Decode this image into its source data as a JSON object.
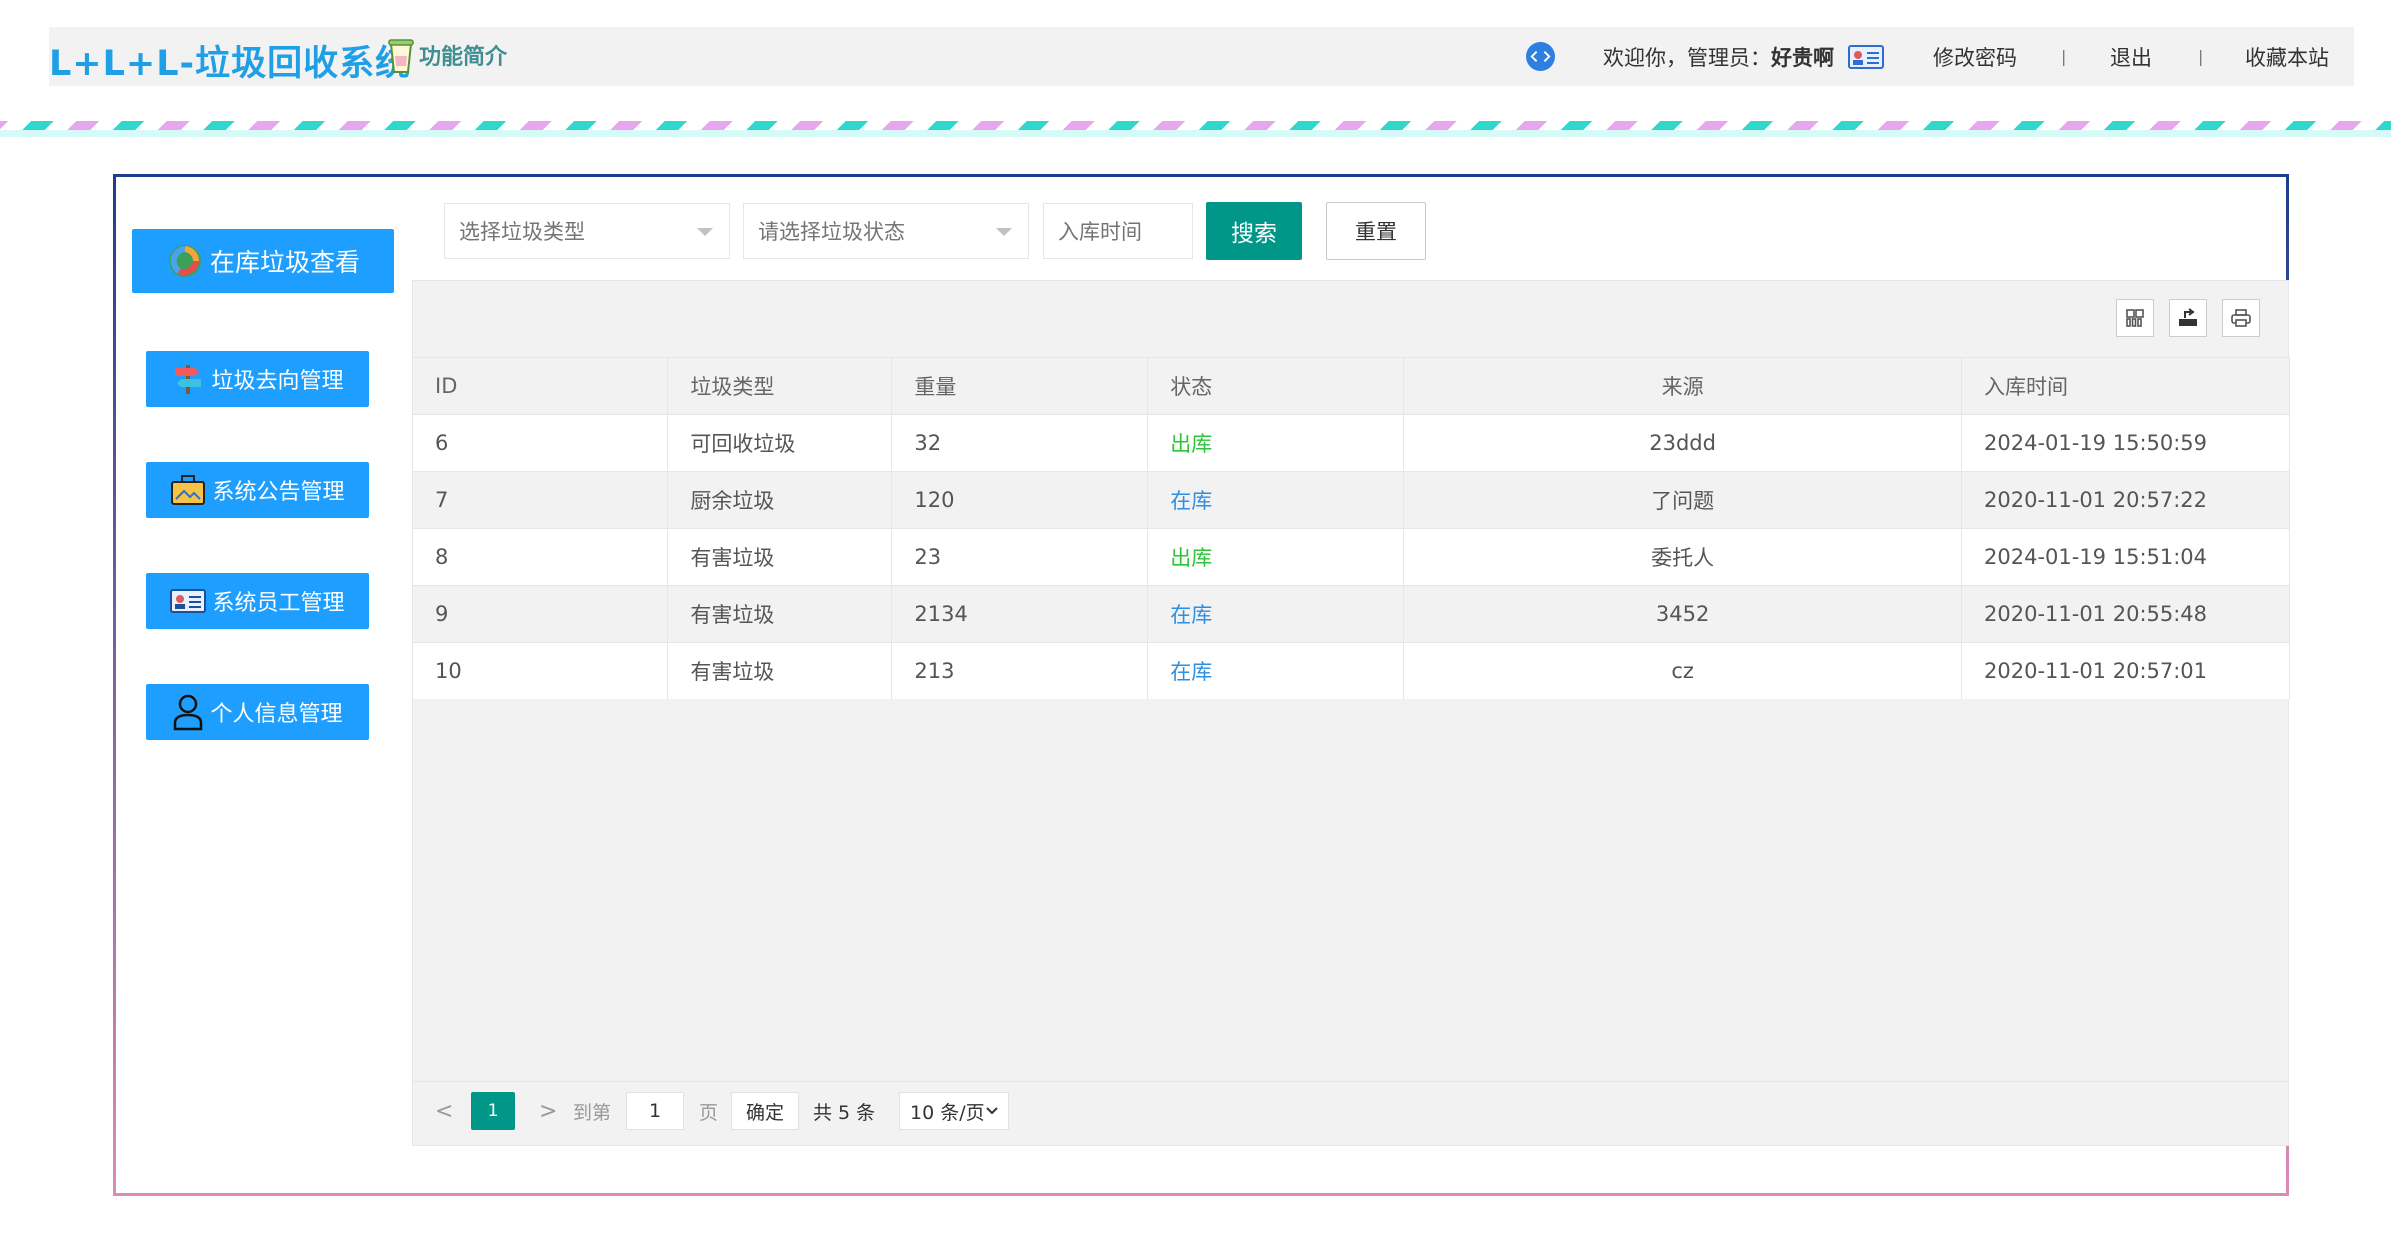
{
  "header": {
    "logo": "L+L+L-垃圾回收系统",
    "intro": "功能简介",
    "welcome_prefix": "欢迎你，管理员：",
    "username": "好贵啊",
    "change_password": "修改密码",
    "sep": "|",
    "logout": "退出",
    "bookmark": "收藏本站"
  },
  "sidebar": {
    "items": [
      {
        "label": "在库垃圾查看",
        "icon": "recycle-icon"
      },
      {
        "label": "垃圾去向管理",
        "icon": "signpost-icon"
      },
      {
        "label": "系统公告管理",
        "icon": "briefcase-icon"
      },
      {
        "label": "系统员工管理",
        "icon": "id-card-icon"
      },
      {
        "label": "个人信息管理",
        "icon": "user-icon"
      }
    ]
  },
  "search": {
    "type_placeholder": "选择垃圾类型",
    "status_placeholder": "请选择垃圾状态",
    "time_placeholder": "入库时间",
    "search_label": "搜索",
    "reset_label": "重置"
  },
  "table": {
    "columns": [
      "ID",
      "垃圾类型",
      "重量",
      "状态",
      "来源",
      "入库时间"
    ],
    "rows": [
      {
        "id": "6",
        "type": "可回收垃圾",
        "weight": "32",
        "status": "出库",
        "source": "23ddd",
        "time": "2024-01-19 15:50:59"
      },
      {
        "id": "7",
        "type": "厨余垃圾",
        "weight": "120",
        "status": "在库",
        "source": "了问题",
        "time": "2020-11-01 20:57:22"
      },
      {
        "id": "8",
        "type": "有害垃圾",
        "weight": "23",
        "status": "出库",
        "source": "委托人",
        "time": "2024-01-19 15:51:04"
      },
      {
        "id": "9",
        "type": "有害垃圾",
        "weight": "2134",
        "status": "在库",
        "source": "3452",
        "time": "2020-11-01 20:55:48"
      },
      {
        "id": "10",
        "type": "有害垃圾",
        "weight": "213",
        "status": "在库",
        "source": "cz",
        "time": "2020-11-01 20:57:01"
      }
    ]
  },
  "pager": {
    "prev": "<",
    "current": "1",
    "next": ">",
    "goto_label": "到第",
    "goto_value": "1",
    "page_unit": "页",
    "confirm": "确定",
    "total": "共 5 条",
    "page_size": "10 条/页"
  },
  "colors": {
    "accent_blue": "#1e9fff",
    "teal": "#009688",
    "status_out": "#2ec43a",
    "status_in": "#2f8fe0"
  }
}
